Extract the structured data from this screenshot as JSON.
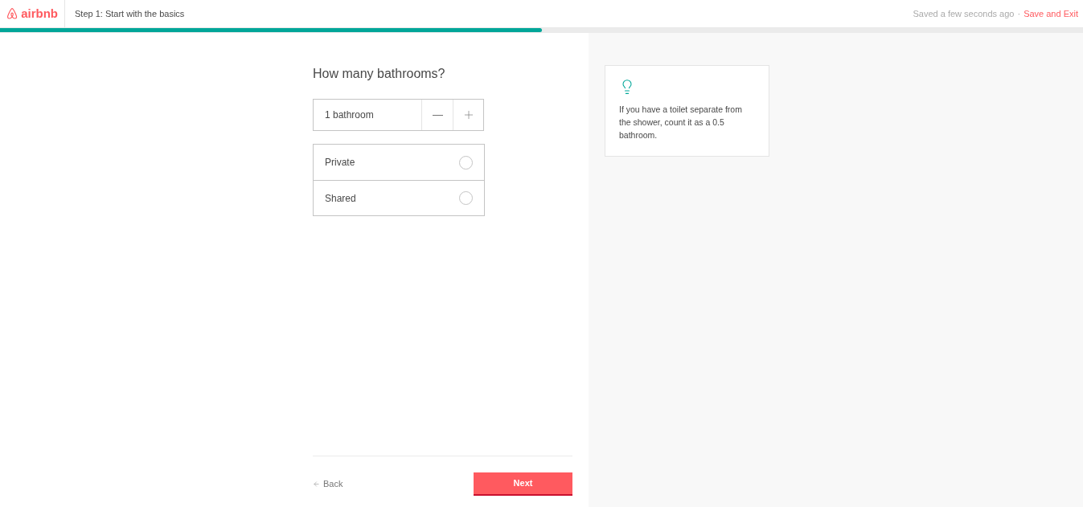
{
  "header": {
    "logo": "airbnb",
    "step": "Step 1: Start with the basics",
    "saved_status": "Saved a few seconds ago",
    "separator": "·",
    "save_exit": "Save and Exit"
  },
  "progress": {
    "level": 0.5
  },
  "question": "How many bathrooms?",
  "stepper": {
    "value": "1 bathroom"
  },
  "options": [
    {
      "label": "Private",
      "selected": false
    },
    {
      "label": "Shared",
      "selected": false
    }
  ],
  "footer": {
    "back": "Back",
    "next": "Next"
  },
  "tip": {
    "text": "If you have a toilet separate from the shower, count it as a 0.5 bathroom."
  }
}
